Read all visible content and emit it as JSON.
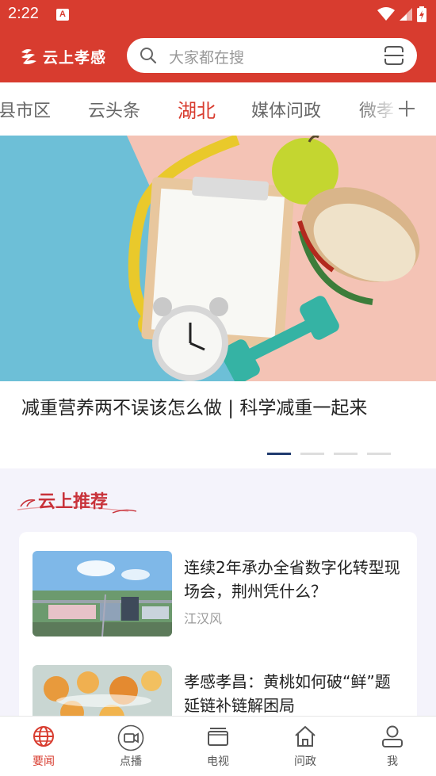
{
  "status": {
    "time": "2:22",
    "notification": "A"
  },
  "brand": {
    "name": "云上孝感",
    "colors": {
      "primary": "#d83c2f",
      "accent": "#1f3a6e"
    }
  },
  "search": {
    "placeholder": "大家都在搜"
  },
  "tabs": [
    {
      "label": "县市区",
      "active": false
    },
    {
      "label": "云头条",
      "active": false
    },
    {
      "label": "湖北",
      "active": true
    },
    {
      "label": "媒体问政",
      "active": false
    },
    {
      "label": "微孝",
      "active": false
    }
  ],
  "banner": {
    "title": "减重营养两不误该怎么做 | 科学减重一起来",
    "pages": 4,
    "current_page": 1
  },
  "recommend": {
    "section_title": "云上推荐",
    "items": [
      {
        "title": "连续2年承办全省数字化转型现场会，荆州凭什么？",
        "source": "江汉风"
      },
      {
        "title": "孝感孝昌：黄桃如何破“鲜”题 延链补链解困局",
        "source": ""
      }
    ]
  },
  "bottom_nav": [
    {
      "label": "要闻",
      "icon": "globe-icon",
      "active": true
    },
    {
      "label": "点播",
      "icon": "video-icon",
      "active": false
    },
    {
      "label": "电视",
      "icon": "tv-icon",
      "active": false
    },
    {
      "label": "问政",
      "icon": "home-icon",
      "active": false
    },
    {
      "label": "我",
      "icon": "user-icon",
      "active": false
    }
  ]
}
